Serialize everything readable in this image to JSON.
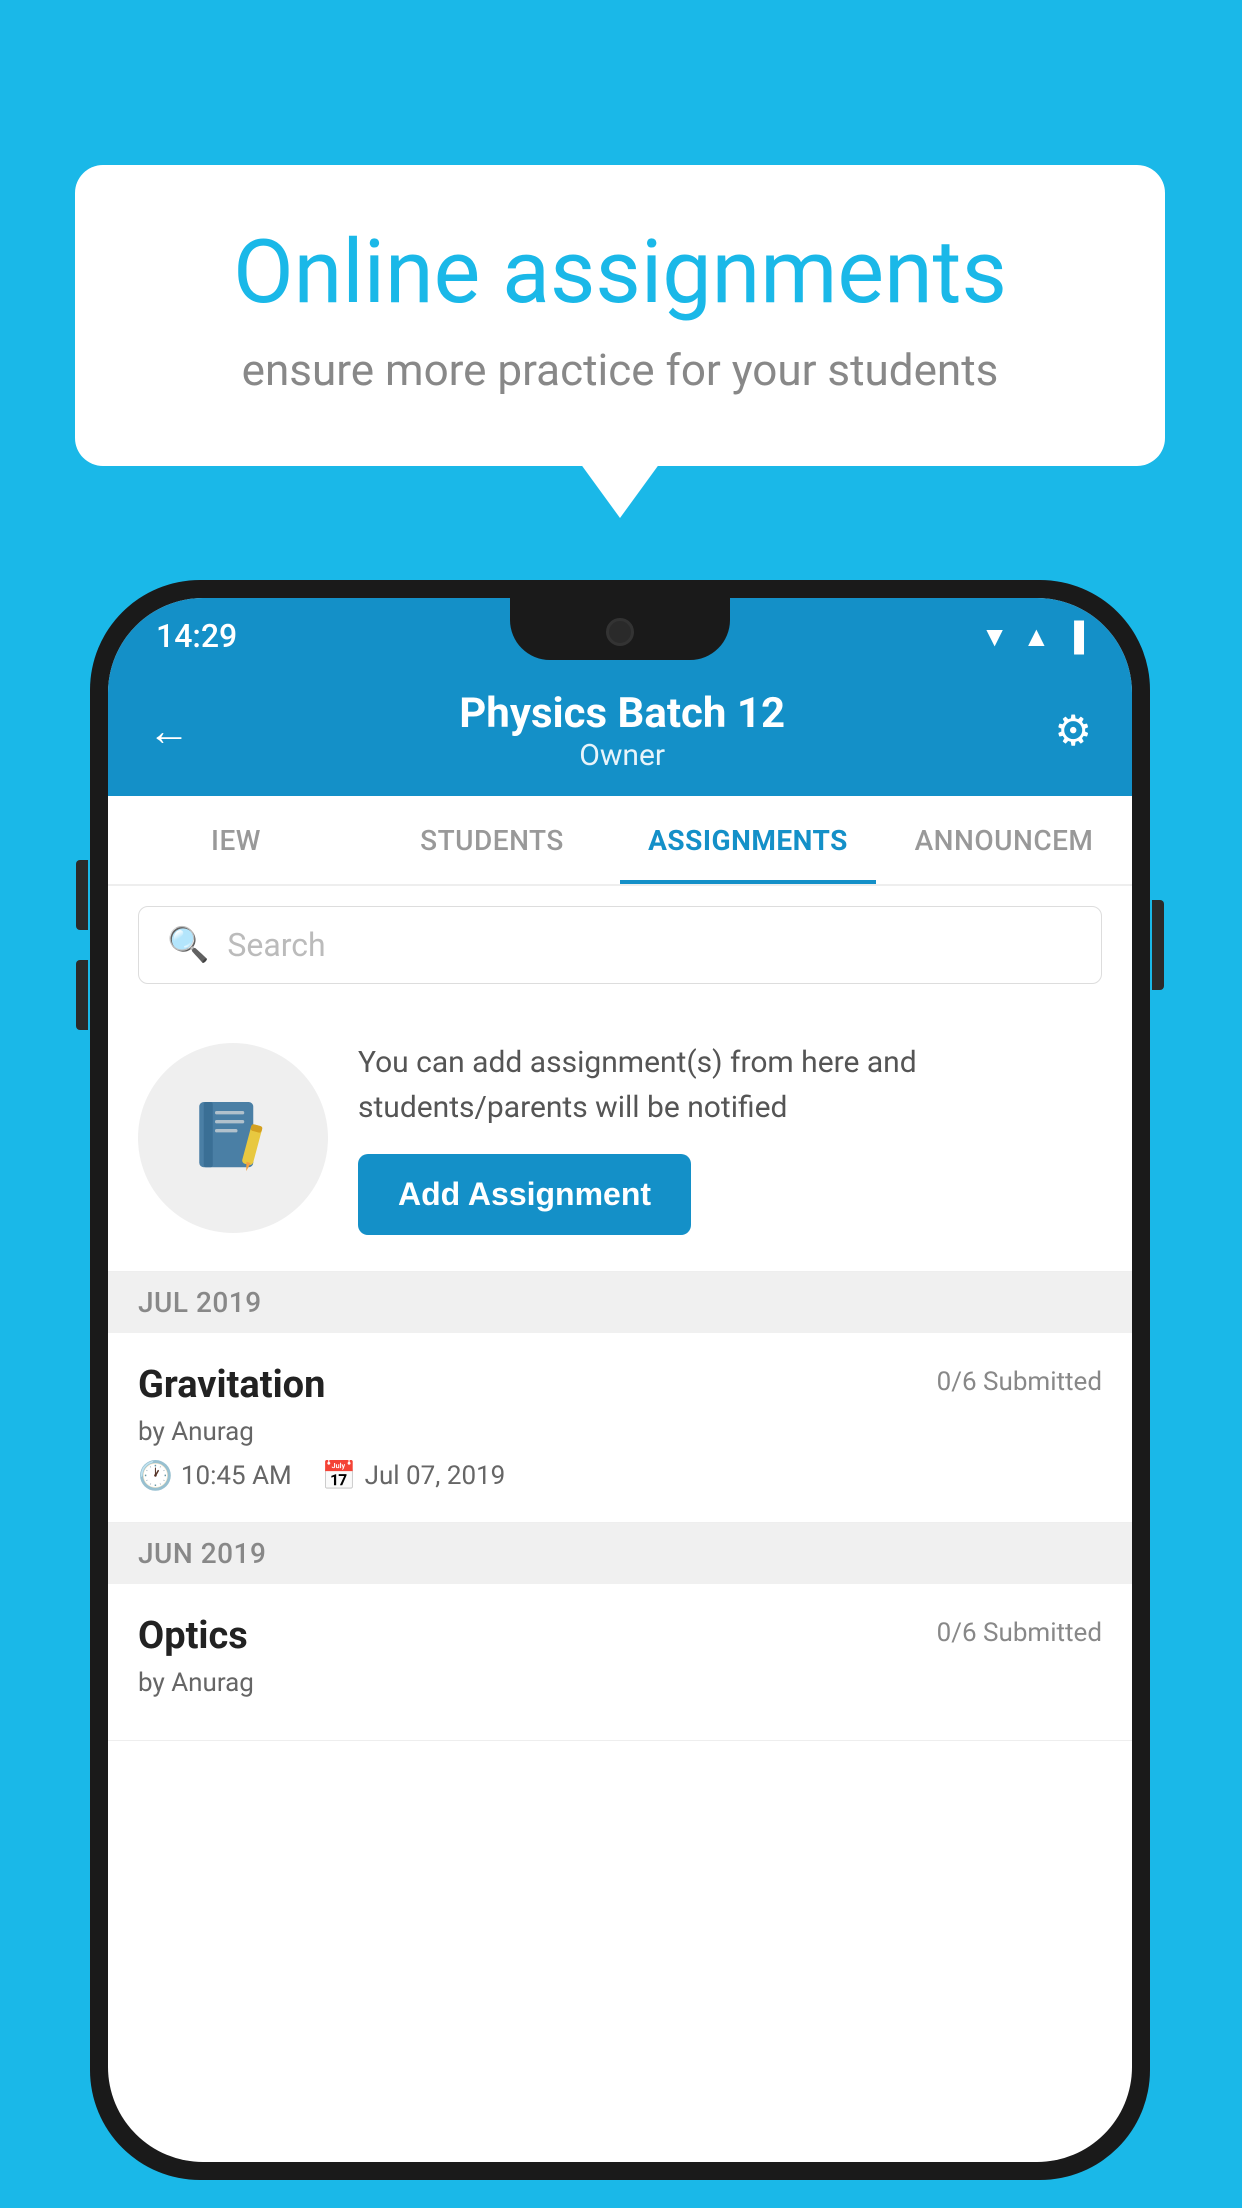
{
  "background": {
    "color": "#1ab8e8"
  },
  "speech_bubble": {
    "title": "Online assignments",
    "subtitle": "ensure more practice for your students"
  },
  "phone": {
    "status_bar": {
      "time": "14:29"
    },
    "header": {
      "title": "Physics Batch 12",
      "subtitle": "Owner"
    },
    "tabs": [
      {
        "label": "IEW",
        "active": false
      },
      {
        "label": "STUDENTS",
        "active": false
      },
      {
        "label": "ASSIGNMENTS",
        "active": true
      },
      {
        "label": "ANNOUNCEM",
        "active": false
      }
    ],
    "search": {
      "placeholder": "Search"
    },
    "promo": {
      "text": "You can add assignment(s) from here and students/parents will be notified",
      "button_label": "Add Assignment"
    },
    "months": [
      {
        "label": "JUL 2019",
        "assignments": [
          {
            "title": "Gravitation",
            "submitted": "0/6 Submitted",
            "author": "by Anurag",
            "time": "10:45 AM",
            "date": "Jul 07, 2019"
          }
        ]
      },
      {
        "label": "JUN 2019",
        "assignments": [
          {
            "title": "Optics",
            "submitted": "0/6 Submitted",
            "author": "by Anurag",
            "time": "",
            "date": ""
          }
        ]
      }
    ]
  }
}
